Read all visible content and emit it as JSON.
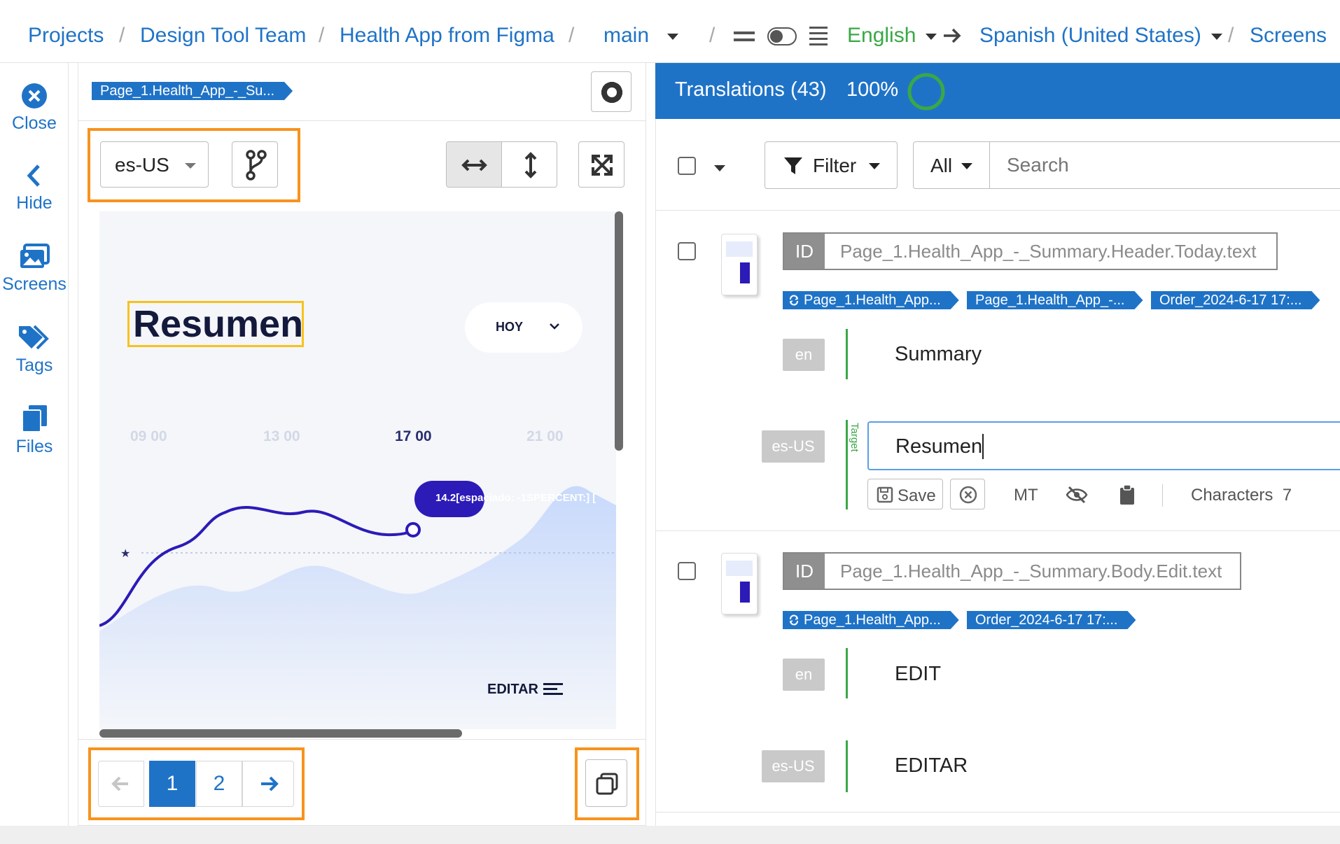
{
  "breadcrumb": {
    "projects": "Projects",
    "team": "Design Tool Team",
    "project": "Health App from Figma",
    "branch": "main",
    "source_lang": "English",
    "target_lang": "Spanish (United States)",
    "screens": "Screens",
    "separator": "/"
  },
  "nav": {
    "close": "Close",
    "hide": "Hide",
    "screens": "Screens",
    "tags": "Tags",
    "files": "Files"
  },
  "preview": {
    "screen_tag": "Page_1.Health_App_-_Su...",
    "locale_select": "es-US",
    "canvas": {
      "title": "Resumen",
      "period": "HOY",
      "hours": [
        "09 00",
        "13 00",
        "17 00",
        "21 00"
      ],
      "bubble": "14.2[espaciado: -1SPERCENT:] [",
      "edit": "EDITAR"
    },
    "pages": [
      "1",
      "2"
    ]
  },
  "translations": {
    "header": "Translations (43)",
    "percent": "100%",
    "filter_label": "Filter",
    "all_label": "All",
    "search_placeholder": "Search",
    "entries": [
      {
        "id_label": "ID",
        "id": "Page_1.Health_App_-_Summary.Header.Today.text",
        "tags": [
          "Page_1.Health_App...",
          "Page_1.Health_App_-...",
          "Order_2024-6-17 17:..."
        ],
        "source_lang": "en",
        "source": "Summary",
        "target_lang": "es-US",
        "target_marker": "Target",
        "target": "Resumen",
        "save": "Save",
        "mt": "MT",
        "characters": "Characters  7"
      },
      {
        "id_label": "ID",
        "id": "Page_1.Health_App_-_Summary.Body.Edit.text",
        "tags": [
          "Page_1.Health_App...",
          "Order_2024-6-17 17:..."
        ],
        "source_lang": "en",
        "source": "EDIT",
        "target_lang": "es-US",
        "target": "EDITAR"
      }
    ]
  },
  "colors": {
    "accent": "#1f73c7",
    "highlight": "#f7931e",
    "green": "#3aa846"
  }
}
